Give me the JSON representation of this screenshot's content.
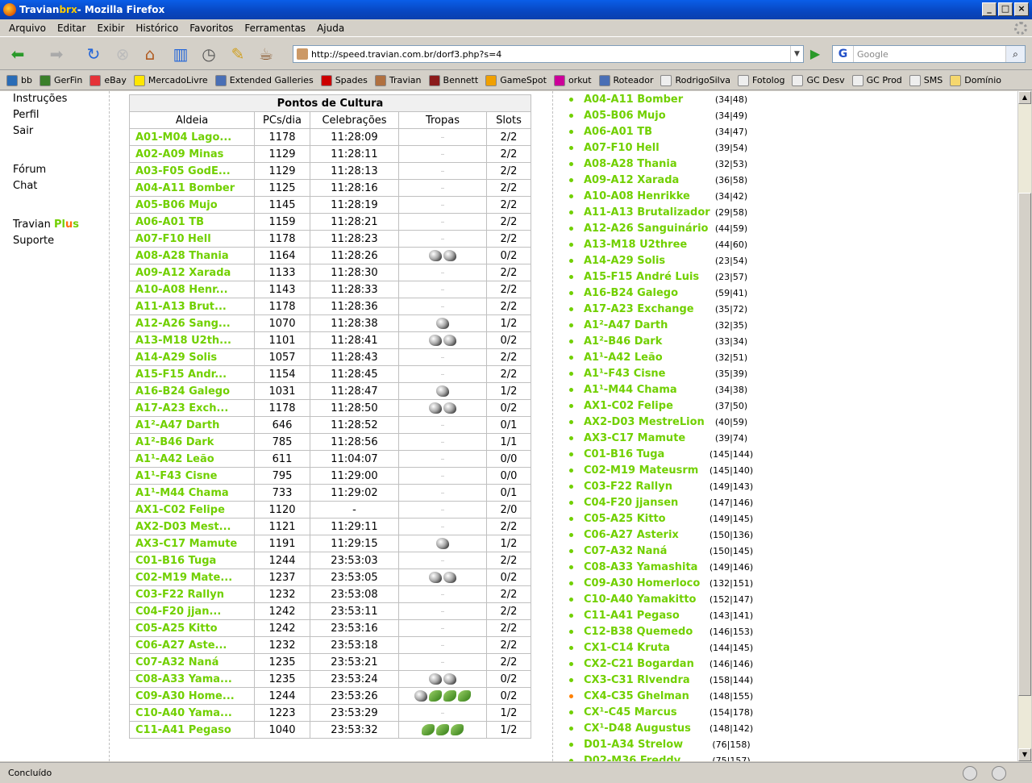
{
  "window": {
    "title_prefix": "Travian ",
    "title_brand": "brx",
    "title_suffix": " - Mozilla Firefox"
  },
  "menu": [
    "Arquivo",
    "Editar",
    "Exibir",
    "Histórico",
    "Favoritos",
    "Ferramentas",
    "Ajuda"
  ],
  "address": {
    "url": "http://speed.travian.com.br/dorf3.php?s=4"
  },
  "search": {
    "engine": "G",
    "placeholder": "Google"
  },
  "bookmarks": [
    {
      "label": "bb",
      "color": "#2a6cb6"
    },
    {
      "label": "GerFin",
      "color": "#3a7f2a"
    },
    {
      "label": "eBay",
      "color": "#e53238"
    },
    {
      "label": "MercadoLivre",
      "color": "#ffe600"
    },
    {
      "label": "Extended Galleries",
      "color": "#4a6fb5"
    },
    {
      "label": "Spades",
      "color": "#cc0000"
    },
    {
      "label": "Travian",
      "color": "#b07040"
    },
    {
      "label": "Bennett",
      "color": "#8b1a1a"
    },
    {
      "label": "GameSpot",
      "color": "#f0a000"
    },
    {
      "label": "orkut",
      "color": "#cc0099"
    },
    {
      "label": "Roteador",
      "color": "#4a6fb5"
    },
    {
      "label": "RodrigoSilva",
      "color": "#eeeeee"
    },
    {
      "label": "Fotolog",
      "color": "#eeeeee"
    },
    {
      "label": "GC Desv",
      "color": "#eeeeee"
    },
    {
      "label": "GC Prod",
      "color": "#eeeeee"
    },
    {
      "label": "SMS",
      "color": "#eeeeee"
    },
    {
      "label": "Domínio",
      "color": "#f5d76e"
    }
  ],
  "leftnav": {
    "instrucoes": "Instruções",
    "perfil": "Perfil",
    "sair": "Sair",
    "forum": "Fórum",
    "chat": "Chat",
    "plus_prefix": "Travian ",
    "plus_p": "P",
    "plus_l": "l",
    "plus_u": "u",
    "plus_s": "s",
    "suporte": "Suporte"
  },
  "culture": {
    "caption": "Pontos de Cultura",
    "headers": [
      "Aldeia",
      "PCs/dia",
      "Celebrações",
      "Tropas",
      "Slots"
    ],
    "rows": [
      {
        "name": "A01-M04 Lago...",
        "pcs": "1178",
        "cel": "11:28:09",
        "troops": "",
        "slots": "2/2"
      },
      {
        "name": "A02-A09 Minas",
        "pcs": "1129",
        "cel": "11:28:11",
        "troops": "",
        "slots": "2/2"
      },
      {
        "name": "A03-F05 GodE...",
        "pcs": "1129",
        "cel": "11:28:13",
        "troops": "",
        "slots": "2/2"
      },
      {
        "name": "A04-A11 Bomber",
        "pcs": "1125",
        "cel": "11:28:16",
        "troops": "",
        "slots": "2/2"
      },
      {
        "name": "A05-B06 Mujo",
        "pcs": "1145",
        "cel": "11:28:19",
        "troops": "",
        "slots": "2/2"
      },
      {
        "name": "A06-A01 TB",
        "pcs": "1159",
        "cel": "11:28:21",
        "troops": "",
        "slots": "2/2"
      },
      {
        "name": "A07-F10 Hell",
        "pcs": "1178",
        "cel": "11:28:23",
        "troops": "",
        "slots": "2/2"
      },
      {
        "name": "A08-A28 Thania",
        "pcs": "1164",
        "cel": "11:28:26",
        "troops": "ww",
        "slots": "0/2"
      },
      {
        "name": "A09-A12 Xarada",
        "pcs": "1133",
        "cel": "11:28:30",
        "troops": "",
        "slots": "2/2"
      },
      {
        "name": "A10-A08 Henr...",
        "pcs": "1143",
        "cel": "11:28:33",
        "troops": "",
        "slots": "2/2"
      },
      {
        "name": "A11-A13 Brut...",
        "pcs": "1178",
        "cel": "11:28:36",
        "troops": "",
        "slots": "2/2"
      },
      {
        "name": "A12-A26 Sang...",
        "pcs": "1070",
        "cel": "11:28:38",
        "troops": "w",
        "slots": "1/2"
      },
      {
        "name": "A13-M18 U2th...",
        "pcs": "1101",
        "cel": "11:28:41",
        "troops": "ww",
        "slots": "0/2"
      },
      {
        "name": "A14-A29 Solis",
        "pcs": "1057",
        "cel": "11:28:43",
        "troops": "",
        "slots": "2/2"
      },
      {
        "name": "A15-F15 Andr...",
        "pcs": "1154",
        "cel": "11:28:45",
        "troops": "",
        "slots": "2/2"
      },
      {
        "name": "A16-B24 Galego",
        "pcs": "1031",
        "cel": "11:28:47",
        "troops": "w",
        "slots": "1/2"
      },
      {
        "name": "A17-A23 Exch...",
        "pcs": "1178",
        "cel": "11:28:50",
        "troops": "ww",
        "slots": "0/2"
      },
      {
        "name": "A1²-A47 Darth",
        "pcs": "646",
        "cel": "11:28:52",
        "troops": "",
        "slots": "0/1"
      },
      {
        "name": "A1²-B46 Dark",
        "pcs": "785",
        "cel": "11:28:56",
        "troops": "",
        "slots": "1/1"
      },
      {
        "name": "A1¹-A42 Leão",
        "pcs": "611",
        "cel": "11:04:07",
        "troops": "",
        "slots": "0/0"
      },
      {
        "name": "A1¹-F43 Cisne",
        "pcs": "795",
        "cel": "11:29:00",
        "troops": "",
        "slots": "0/0"
      },
      {
        "name": "A1¹-M44 Chama",
        "pcs": "733",
        "cel": "11:29:02",
        "troops": "",
        "slots": "0/1"
      },
      {
        "name": "AX1-C02 Felipe",
        "pcs": "1120",
        "cel": "-",
        "troops": "",
        "slots": "2/0"
      },
      {
        "name": "AX2-D03 Mest...",
        "pcs": "1121",
        "cel": "11:29:11",
        "troops": "",
        "slots": "2/2"
      },
      {
        "name": "AX3-C17 Mamute",
        "pcs": "1191",
        "cel": "11:29:15",
        "troops": "w",
        "slots": "1/2"
      },
      {
        "name": "C01-B16 Tuga",
        "pcs": "1244",
        "cel": "23:53:03",
        "troops": "",
        "slots": "2/2"
      },
      {
        "name": "C02-M19 Mate...",
        "pcs": "1237",
        "cel": "23:53:05",
        "troops": "ww",
        "slots": "0/2"
      },
      {
        "name": "C03-F22 Rallyn",
        "pcs": "1232",
        "cel": "23:53:08",
        "troops": "",
        "slots": "2/2"
      },
      {
        "name": "C04-F20 jjan...",
        "pcs": "1242",
        "cel": "23:53:11",
        "troops": "",
        "slots": "2/2"
      },
      {
        "name": "C05-A25 Kitto",
        "pcs": "1242",
        "cel": "23:53:16",
        "troops": "",
        "slots": "2/2"
      },
      {
        "name": "C06-A27 Aste...",
        "pcs": "1232",
        "cel": "23:53:18",
        "troops": "",
        "slots": "2/2"
      },
      {
        "name": "C07-A32 Naná",
        "pcs": "1235",
        "cel": "23:53:21",
        "troops": "",
        "slots": "2/2"
      },
      {
        "name": "C08-A33 Yama...",
        "pcs": "1235",
        "cel": "23:53:24",
        "troops": "ww",
        "slots": "0/2"
      },
      {
        "name": "C09-A30 Home...",
        "pcs": "1244",
        "cel": "23:53:26",
        "troops": "wggg",
        "slots": "0/2"
      },
      {
        "name": "C10-A40 Yama...",
        "pcs": "1223",
        "cel": "23:53:29",
        "troops": "",
        "slots": "1/2"
      },
      {
        "name": "C11-A41 Pegaso",
        "pcs": "1040",
        "cel": "23:53:32",
        "troops": "ggg",
        "slots": "1/2"
      }
    ]
  },
  "villages": [
    {
      "name": "A04-A11 Bomber",
      "coords": "(34|48)"
    },
    {
      "name": "A05-B06 Mujo",
      "coords": "(34|49)"
    },
    {
      "name": "A06-A01 TB",
      "coords": "(34|47)"
    },
    {
      "name": "A07-F10 Hell",
      "coords": "(39|54)"
    },
    {
      "name": "A08-A28 Thania",
      "coords": "(32|53)"
    },
    {
      "name": "A09-A12 Xarada",
      "coords": "(36|58)"
    },
    {
      "name": "A10-A08 Henrikke",
      "coords": "(34|42)"
    },
    {
      "name": "A11-A13 Brutalizador",
      "coords": "(29|58)"
    },
    {
      "name": "A12-A26 Sanguinário",
      "coords": "(44|59)"
    },
    {
      "name": "A13-M18 U2three",
      "coords": "(44|60)"
    },
    {
      "name": "A14-A29 Solis",
      "coords": "(23|54)"
    },
    {
      "name": "A15-F15 André Luis",
      "coords": "(23|57)"
    },
    {
      "name": "A16-B24 Galego",
      "coords": "(59|41)"
    },
    {
      "name": "A17-A23 Exchange",
      "coords": "(35|72)"
    },
    {
      "name": "A1²-A47 Darth",
      "coords": "(32|35)"
    },
    {
      "name": "A1²-B46 Dark",
      "coords": "(33|34)"
    },
    {
      "name": "A1¹-A42 Leão",
      "coords": "(32|51)"
    },
    {
      "name": "A1¹-F43 Cisne",
      "coords": "(35|39)"
    },
    {
      "name": "A1¹-M44 Chama",
      "coords": "(34|38)"
    },
    {
      "name": "AX1-C02 Felipe",
      "coords": "(37|50)"
    },
    {
      "name": "AX2-D03 MestreLion",
      "coords": "(40|59)"
    },
    {
      "name": "AX3-C17 Mamute",
      "coords": "(39|74)"
    },
    {
      "name": "C01-B16 Tuga",
      "coords": "(145|144)"
    },
    {
      "name": "C02-M19 Mateusrm",
      "coords": "(145|140)"
    },
    {
      "name": "C03-F22 Rallyn",
      "coords": "(149|143)"
    },
    {
      "name": "C04-F20 jjansen",
      "coords": "(147|146)"
    },
    {
      "name": "C05-A25 Kitto",
      "coords": "(149|145)"
    },
    {
      "name": "C06-A27 Asterix",
      "coords": "(150|136)"
    },
    {
      "name": "C07-A32 Naná",
      "coords": "(150|145)"
    },
    {
      "name": "C08-A33 Yamashita",
      "coords": "(149|146)"
    },
    {
      "name": "C09-A30 Homerloco",
      "coords": "(132|151)"
    },
    {
      "name": "C10-A40 Yamakitto",
      "coords": "(152|147)"
    },
    {
      "name": "C11-A41 Pegaso",
      "coords": "(143|141)"
    },
    {
      "name": "C12-B38 Quemedo",
      "coords": "(146|153)"
    },
    {
      "name": "CX1-C14 Kruta",
      "coords": "(144|145)"
    },
    {
      "name": "CX2-C21 Bogardan",
      "coords": "(146|146)"
    },
    {
      "name": "CX3-C31 Rlvendra",
      "coords": "(158|144)"
    },
    {
      "name": "CX4-C35 Ghelman",
      "coords": "(148|155)",
      "active": true
    },
    {
      "name": "CX¹-C45 Marcus",
      "coords": "(154|178)"
    },
    {
      "name": "CX¹-D48 Augustus",
      "coords": "(148|142)"
    },
    {
      "name": "D01-A34 Strelow",
      "coords": "(76|158)"
    },
    {
      "name": "D02-M36 Freddy",
      "coords": "(75|157)"
    }
  ],
  "status": {
    "text": "Concluído"
  },
  "colors": {
    "link_green": "#71d000",
    "active_dot": "#ff8000"
  }
}
